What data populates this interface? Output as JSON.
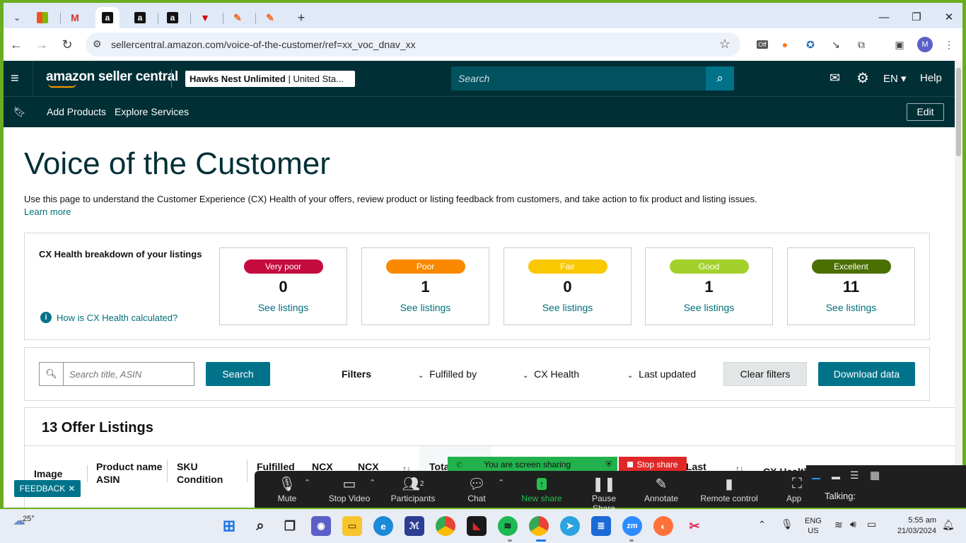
{
  "browser": {
    "tabs": [
      {
        "icon": "windows-icon"
      },
      {
        "icon": "gmail-icon"
      },
      {
        "icon": "amazon-icon",
        "active": true
      },
      {
        "icon": "amazon-icon"
      },
      {
        "icon": "amazon-icon"
      },
      {
        "icon": "triangle-icon"
      },
      {
        "icon": "pen-icon"
      },
      {
        "icon": "pen-icon"
      }
    ],
    "url": "sellercentral.amazon.com/voice-of-the-customer/ref=xx_voc_dnav_xx",
    "profile_initial": "M",
    "ext_badge": "Off"
  },
  "amazon": {
    "logo": "amazon seller central",
    "store": "Hawks Nest Unlimited",
    "marketplace": "United Sta...",
    "search_placeholder": "Search",
    "language": "EN",
    "help": "Help",
    "nav": [
      "Add Products",
      "Explore Services"
    ],
    "edit": "Edit"
  },
  "page": {
    "title": "Voice of the Customer",
    "description": "Use this page to understand the Customer Experience (CX) Health of your offers, review product or listing feedback from customers, and take action to fix product and listing issues.",
    "learn_more": "Learn more",
    "breakdown_title": "CX Health breakdown of your listings",
    "how_calculated": "How is CX Health calculated?",
    "cards": [
      {
        "label": "Very poor",
        "count": "0",
        "link": "See listings",
        "color": "#c40a3e"
      },
      {
        "label": "Poor",
        "count": "1",
        "link": "See listings",
        "color": "#fa8900"
      },
      {
        "label": "Fair",
        "count": "0",
        "link": "See listings",
        "color": "#fac800"
      },
      {
        "label": "Good",
        "count": "1",
        "link": "See listings",
        "color": "#a3d12b"
      },
      {
        "label": "Excellent",
        "count": "11",
        "link": "See listings",
        "color": "#497000"
      }
    ],
    "search_placeholder": "Search title, ASIN",
    "search_button": "Search",
    "filters_label": "Filters",
    "filters": [
      "Fulfilled by",
      "CX Health",
      "Last updated"
    ],
    "clear_filters": "Clear filters",
    "download": "Download data",
    "listings_title": "13 Offer Listings",
    "columns": {
      "image": "Image",
      "product": "Product name",
      "asin": "ASIN",
      "sku": "SKU",
      "condition": "Condition",
      "fulfilled": "Fulfilled",
      "ncx1": "NCX",
      "ncx2": "NCX",
      "total": "Tota",
      "last": "Last",
      "cxhealth": "CX Health"
    },
    "feedback": "FEEDBACK"
  },
  "zoom": {
    "sharing_banner": "You are screen sharing",
    "stop_share": "Stop share",
    "participants_count": "2",
    "buttons": [
      "Mute",
      "Stop Video",
      "Participants",
      "Chat",
      "New share",
      "Pause Share",
      "Annotate",
      "Remote control",
      "App"
    ],
    "talking": "Talking:"
  },
  "taskbar": {
    "weather": "25°",
    "lang1": "ENG",
    "lang2": "US",
    "time": "5:55 am",
    "date": "21/03/2024"
  }
}
